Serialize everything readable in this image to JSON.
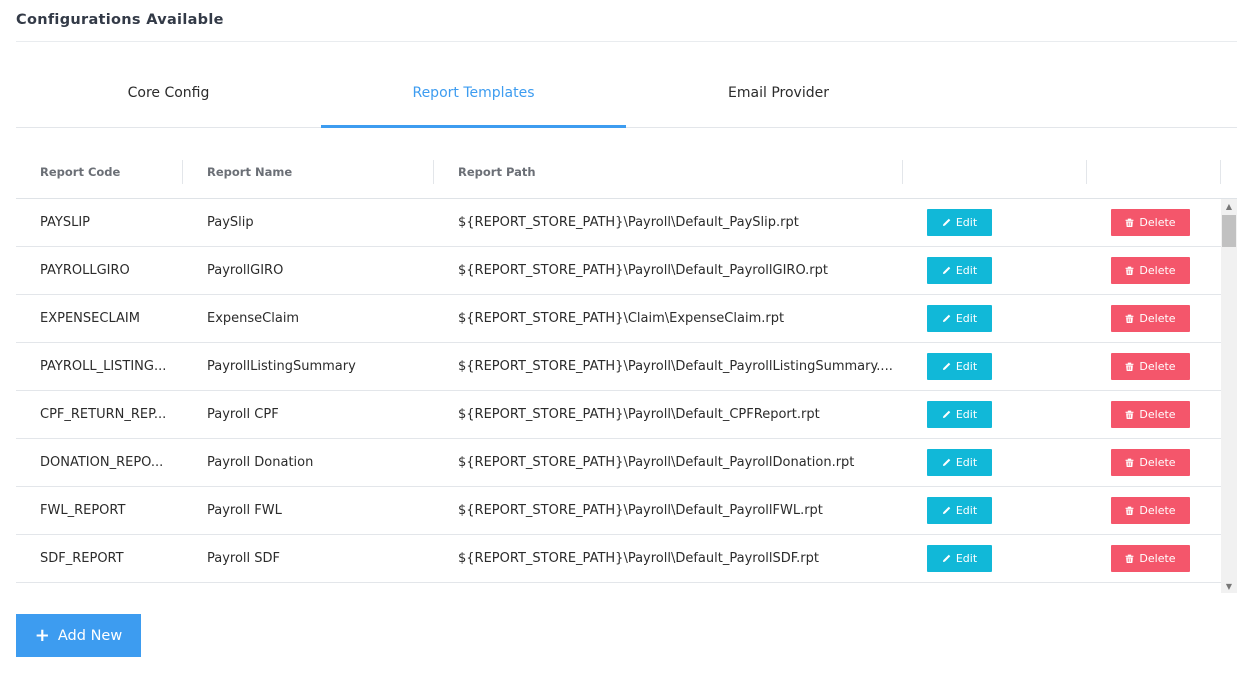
{
  "page": {
    "title": "Configurations Available"
  },
  "tabs": [
    {
      "label": "Core Config",
      "active": false
    },
    {
      "label": "Report Templates",
      "active": true
    },
    {
      "label": "Email Provider",
      "active": false
    }
  ],
  "table": {
    "headers": [
      "Report Code",
      "Report Name",
      "Report Path",
      "",
      ""
    ],
    "edit_label": "Edit",
    "delete_label": "Delete",
    "rows": [
      {
        "code": "PAYSLIP",
        "name": "PaySlip",
        "path": "${REPORT_STORE_PATH}\\Payroll\\Default_PaySlip.rpt"
      },
      {
        "code": "PAYROLLGIRO",
        "name": "PayrollGIRO",
        "path": "${REPORT_STORE_PATH}\\Payroll\\Default_PayrollGIRO.rpt"
      },
      {
        "code": "EXPENSECLAIM",
        "name": "ExpenseClaim",
        "path": "${REPORT_STORE_PATH}\\Claim\\ExpenseClaim.rpt"
      },
      {
        "code": "PAYROLL_LISTING...",
        "name": "PayrollListingSummary",
        "path": "${REPORT_STORE_PATH}\\Payroll\\Default_PayrollListingSummary...."
      },
      {
        "code": "CPF_RETURN_REP...",
        "name": "Payroll CPF",
        "path": "${REPORT_STORE_PATH}\\Payroll\\Default_CPFReport.rpt"
      },
      {
        "code": "DONATION_REPO...",
        "name": "Payroll Donation",
        "path": "${REPORT_STORE_PATH}\\Payroll\\Default_PayrollDonation.rpt"
      },
      {
        "code": "FWL_REPORT",
        "name": "Payroll FWL",
        "path": "${REPORT_STORE_PATH}\\Payroll\\Default_PayrollFWL.rpt"
      },
      {
        "code": "SDF_REPORT",
        "name": "Payroll SDF",
        "path": "${REPORT_STORE_PATH}\\Payroll\\Default_PayrollSDF.rpt"
      }
    ]
  },
  "icons": {
    "edit": "pencil-icon",
    "delete": "trash-icon",
    "add": "plus-icon"
  },
  "colors": {
    "accent": "#3d9cf0",
    "edit": "#11b8d8",
    "delete": "#f4566b"
  },
  "add_button": {
    "label": "Add New"
  }
}
